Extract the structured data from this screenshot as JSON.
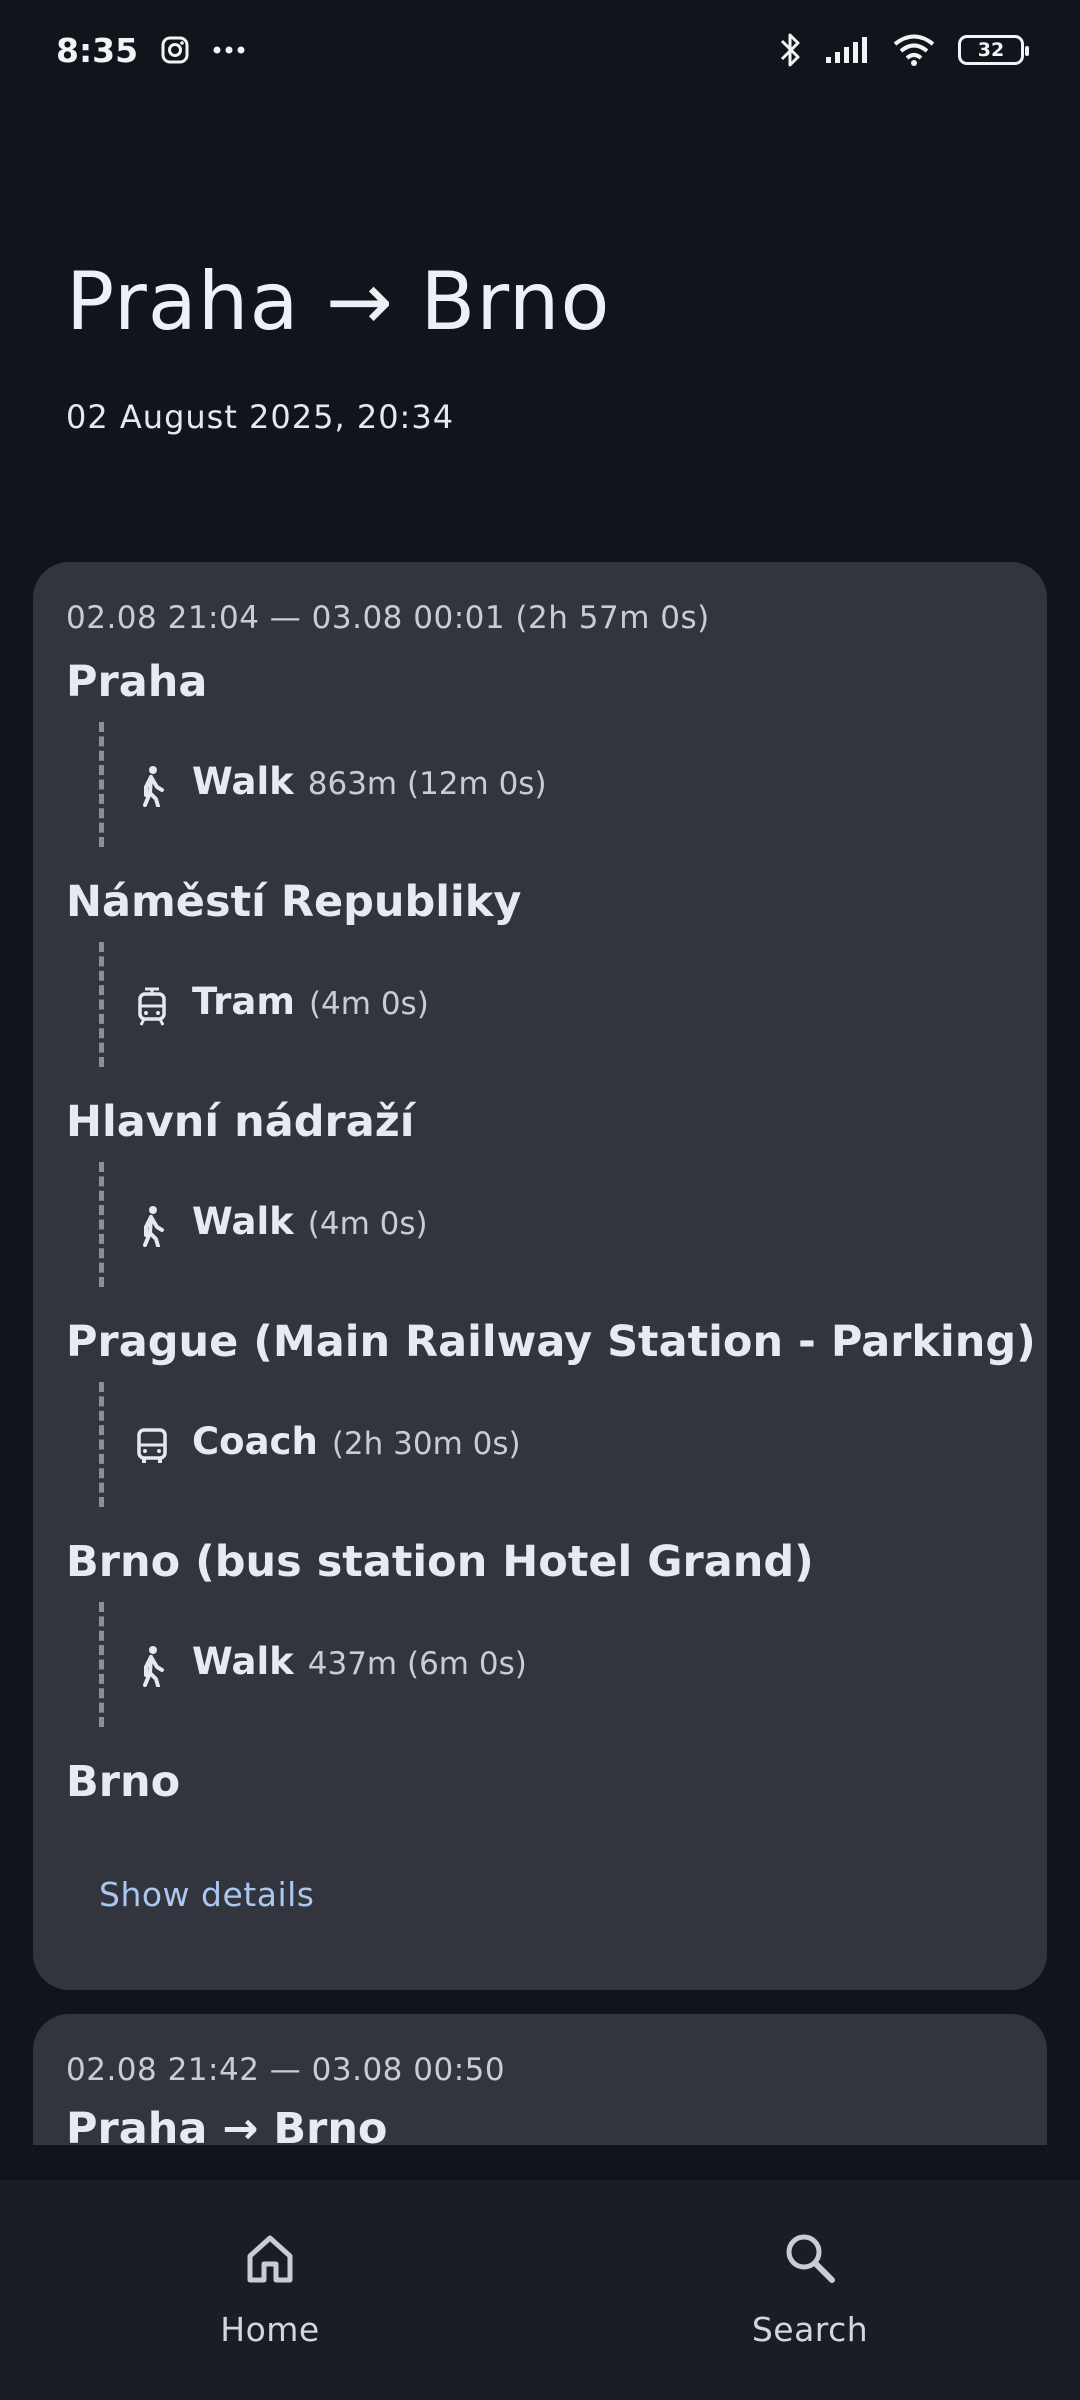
{
  "status_bar": {
    "time": "8:35",
    "battery": "32",
    "icons": [
      "instagram-icon",
      "more-dots-icon",
      "bluetooth-icon",
      "signal-icon",
      "wifi-icon",
      "battery-icon"
    ]
  },
  "header": {
    "title": "Praha → Brno",
    "date": "02 August 2025, 20:34"
  },
  "trips": [
    {
      "summary": "02.08 21:04 — 03.08 00:01 (2h 57m 0s)",
      "stops": [
        "Praha",
        "Náměstí Republiky",
        "Hlavní nádraží",
        "Prague (Main Railway Station - Parking)",
        "Brno (bus station Hotel Grand)",
        "Brno"
      ],
      "legs": [
        {
          "mode": "Walk",
          "info": "863m (12m 0s)",
          "icon": "walk-icon"
        },
        {
          "mode": "Tram",
          "info": "(4m 0s)",
          "icon": "tram-icon"
        },
        {
          "mode": "Walk",
          "info": "(4m 0s)",
          "icon": "walk-icon"
        },
        {
          "mode": "Coach",
          "info": "(2h 30m 0s)",
          "icon": "bus-icon"
        },
        {
          "mode": "Walk",
          "info": "437m (6m 0s)",
          "icon": "walk-icon"
        }
      ],
      "show_details": "Show details"
    },
    {
      "summary": "02.08 21:42 — 03.08 00:50",
      "title": "Praha → Brno"
    }
  ],
  "bottom_nav": [
    {
      "label": "Home",
      "icon": "home-icon"
    },
    {
      "label": "Search",
      "icon": "search-icon"
    }
  ],
  "colors": {
    "background": "#11141b",
    "card": "#32353e",
    "link": "#a9c7f0",
    "nav_bg": "#1b1d25"
  }
}
